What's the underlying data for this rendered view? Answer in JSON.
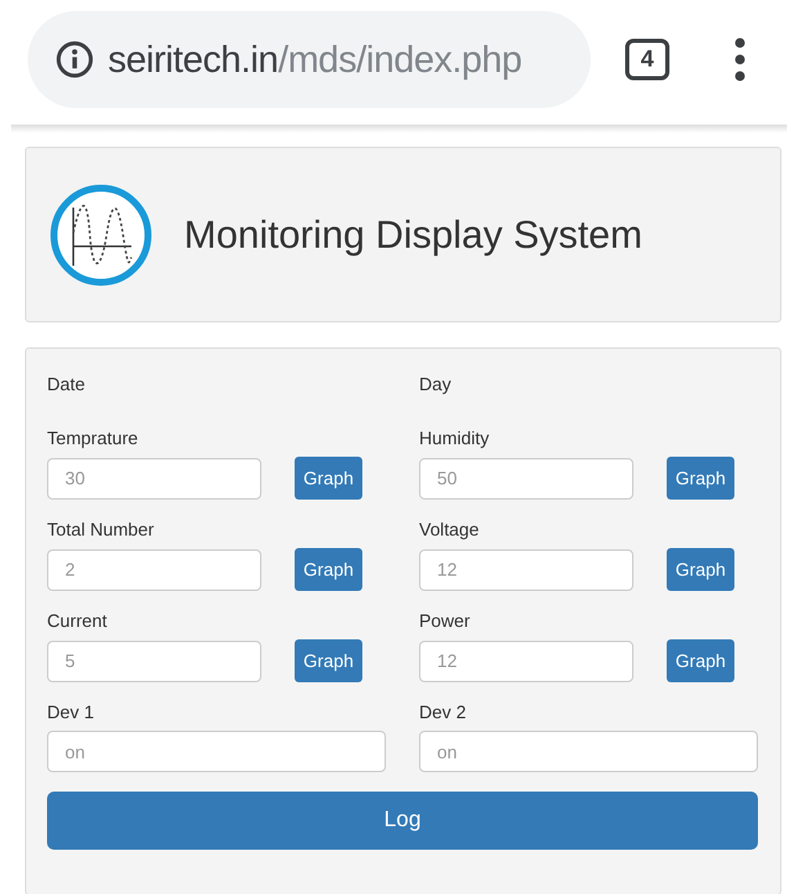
{
  "browser": {
    "url_host": "seiritech.in",
    "url_path": "/mds/index.php",
    "tab_count": "4"
  },
  "header": {
    "title": "Monitoring Display System"
  },
  "form": {
    "items": [
      {
        "kind": "heading",
        "label": "Date"
      },
      {
        "kind": "heading",
        "label": "Day"
      },
      {
        "kind": "sensor",
        "label": "Temprature",
        "placeholder": "30",
        "button": "Graph"
      },
      {
        "kind": "sensor",
        "label": "Humidity",
        "placeholder": "50",
        "button": "Graph"
      },
      {
        "kind": "sensor",
        "label": "Total Number",
        "placeholder": "2",
        "button": "Graph"
      },
      {
        "kind": "sensor",
        "label": "Voltage",
        "placeholder": "12",
        "button": "Graph"
      },
      {
        "kind": "sensor",
        "label": "Current",
        "placeholder": "5",
        "button": "Graph"
      },
      {
        "kind": "sensor",
        "label": "Power",
        "placeholder": "12",
        "button": "Graph"
      },
      {
        "kind": "text",
        "label": "Dev 1",
        "placeholder": "on"
      },
      {
        "kind": "text",
        "label": "Dev 2",
        "placeholder": "on"
      }
    ],
    "submit": "Log"
  }
}
